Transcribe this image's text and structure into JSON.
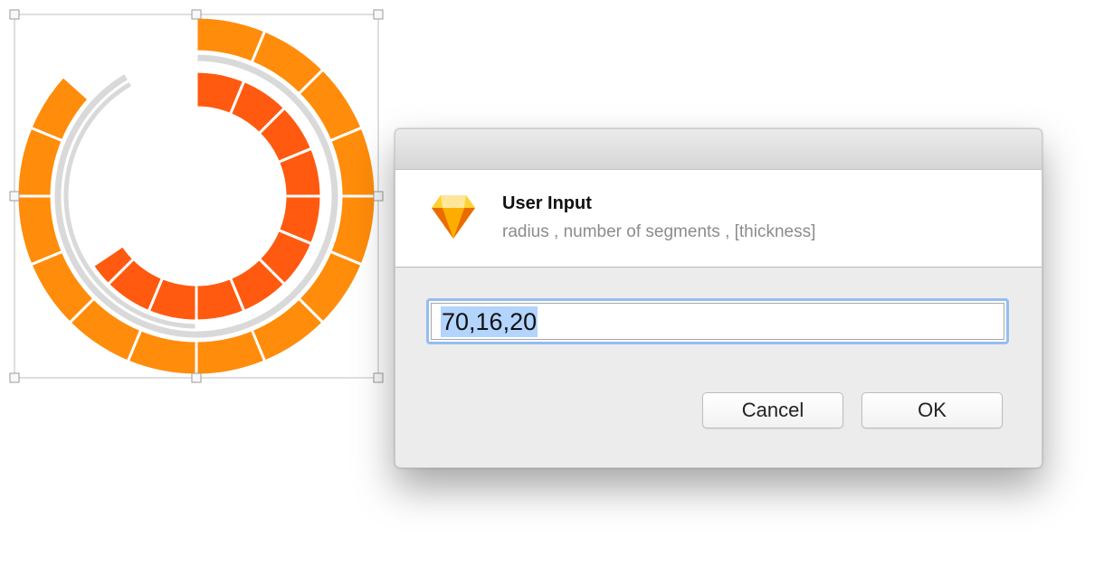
{
  "dialog": {
    "title": "User Input",
    "subtitle": "radius , number of segments , [thickness]",
    "input_value": "70,16,20",
    "cancel_label": "Cancel",
    "ok_label": "OK",
    "app_icon": "sketch-diamond-icon"
  },
  "colors": {
    "outer_ring": "#ff8c0a",
    "inner_ring": "#ff5a10",
    "track": "#d9d9d9",
    "selection": "#b3d4fc",
    "focus_ring": "#95bdf0",
    "subtitle": "#8c8c8c"
  }
}
